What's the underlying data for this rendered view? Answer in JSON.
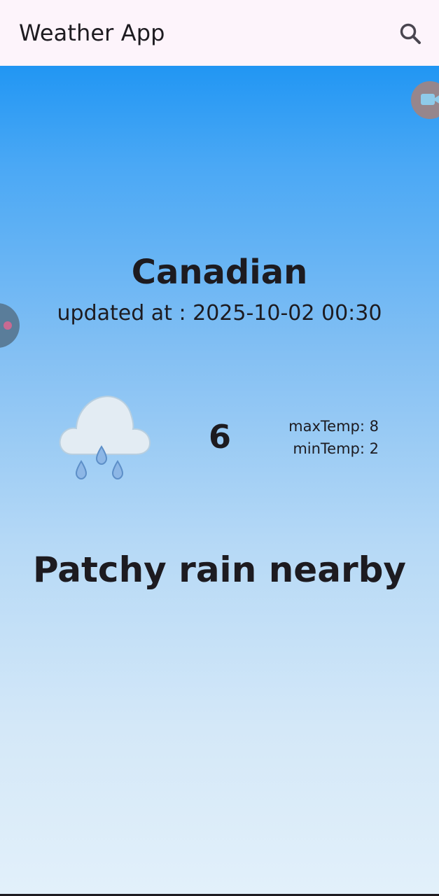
{
  "app_bar": {
    "title": "Weather App",
    "search_icon": "search-icon"
  },
  "weather": {
    "city": "Canadian",
    "updated_at": "updated at : 2025-10-02 00:30",
    "temperature": "6",
    "max_temp": "maxTemp: 8",
    "min_temp": "minTemp: 2",
    "condition": "Patchy rain nearby",
    "condition_icon": "cloud-rain-icon"
  },
  "overlays": {
    "left_bubble_icon": "record-dot-icon",
    "right_bubble_icon": "video-camera-icon"
  },
  "colors": {
    "app_bar_bg": "#fdf4fb",
    "gradient_top": "#2196f3",
    "gradient_bottom": "#e2f0fa",
    "text": "#1d1b20"
  }
}
